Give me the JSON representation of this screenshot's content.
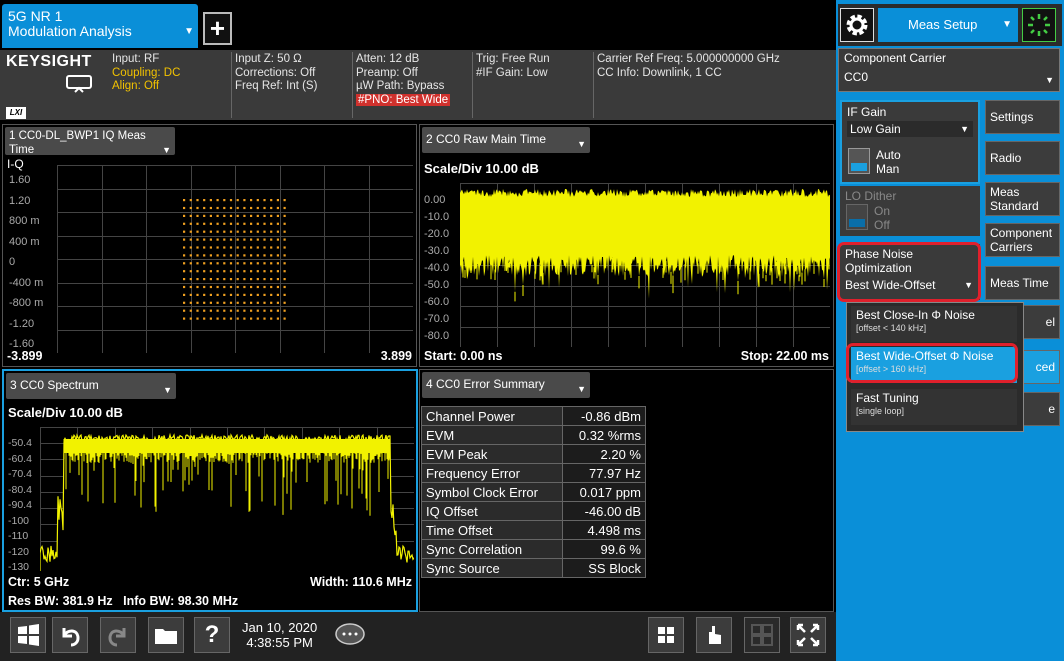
{
  "tab": {
    "line1": "5G NR 1",
    "line2": "Modulation Analysis"
  },
  "add_tab_label": "+",
  "brand": "KEYSIGHT",
  "lxi": "LXI",
  "info": {
    "col1": [
      "Input: RF",
      "Coupling: DC",
      "Align: Off"
    ],
    "col2": [
      "Input Z: 50 Ω",
      "Corrections: Off",
      "Freq Ref: Int (S)"
    ],
    "col3": [
      "Atten: 12 dB",
      "Preamp: Off",
      "µW Path: Bypass",
      "#PNO: Best Wide"
    ],
    "col4": [
      "Trig: Free Run",
      "#IF Gain: Low"
    ],
    "col5": [
      "Carrier Ref Freq: 5.000000000 GHz",
      "CC Info: Downlink, 1 CC"
    ]
  },
  "win1": {
    "title": "1 CC0-DL_BWP1  IQ Meas Time",
    "trace": "I-Q",
    "yticks": [
      "1.60",
      "1.20",
      "800 m",
      "400 m",
      "0",
      "-400 m",
      "-800 m",
      "-1.20",
      "-1.60"
    ],
    "xmin": "-3.899",
    "xmax": "3.899"
  },
  "win2": {
    "title": "2 CC0 Raw Main Time",
    "scale": "Scale/Div 10.00 dB",
    "yticks": [
      "0.00",
      "-10.0",
      "-20.0",
      "-30.0",
      "-40.0",
      "-50.0",
      "-60.0",
      "-70.0",
      "-80.0"
    ],
    "start": "Start: 0.00 ns",
    "stop": "Stop: 22.00 ms"
  },
  "win3": {
    "title": "3 CC0 Spectrum",
    "scale": "Scale/Div 10.00 dB",
    "yticks": [
      "-50.4",
      "-60.4",
      "-70.4",
      "-80.4",
      "-90.4",
      "-100",
      "-110",
      "-120",
      "-130"
    ],
    "ctr": "Ctr: 5 GHz",
    "width": "Width: 110.6 MHz",
    "resbw": "Res BW: 381.9 Hz",
    "infobw": "Info BW: 98.30 MHz"
  },
  "win4": {
    "title": "4 CC0 Error Summary",
    "rows": [
      {
        "label": "Channel Power",
        "value": "-0.86 dBm"
      },
      {
        "label": "EVM",
        "value": "0.32 %rms"
      },
      {
        "label": "EVM Peak",
        "value": "2.20 %"
      },
      {
        "label": "Frequency Error",
        "value": "77.97 Hz"
      },
      {
        "label": "Symbol Clock Error",
        "value": "0.017 ppm"
      },
      {
        "label": "IQ Offset",
        "value": "-46.00 dB"
      },
      {
        "label": "Time Offset",
        "value": "4.498 ms"
      },
      {
        "label": "Sync Correlation",
        "value": "99.6 %"
      },
      {
        "label": "Sync Source",
        "value": "SS Block"
      }
    ]
  },
  "datetime": {
    "date": "Jan 10, 2020",
    "time": "4:38:55 PM"
  },
  "panel": {
    "menu": "Meas Setup",
    "cc_label": "Component Carrier",
    "cc_value": "CC0",
    "if_gain_label": "IF Gain",
    "if_gain_value": "Low Gain",
    "auto": "Auto",
    "man": "Man",
    "lo_dither": "LO Dither",
    "on": "On",
    "off": "Off",
    "pno_label1": "Phase Noise",
    "pno_label2": "Optimization",
    "pno_value": "Best Wide-Offset",
    "softkeys": [
      "Settings",
      "Radio",
      "Meas Standard",
      "Component Carriers",
      "Meas Time",
      "el",
      "ced",
      "e"
    ],
    "popup": [
      {
        "title": "Best Close-In Φ Noise",
        "sub": "[offset < 140 kHz]"
      },
      {
        "title": "Best Wide-Offset Φ Noise",
        "sub": "[offset > 160 kHz]"
      },
      {
        "title": "Fast Tuning",
        "sub": "[single loop]"
      }
    ]
  }
}
